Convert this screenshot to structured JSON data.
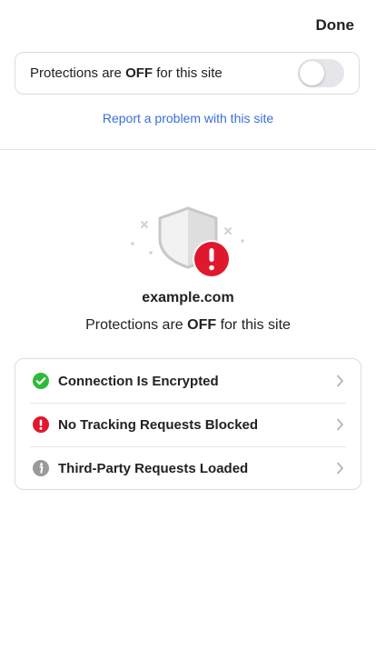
{
  "header": {
    "done_label": "Done"
  },
  "protection_toggle": {
    "prefix": "Protections are ",
    "state": "OFF",
    "suffix": " for this site",
    "enabled": false
  },
  "report_link": "Report a problem with this site",
  "site": {
    "domain": "example.com",
    "status_prefix": "Protections are ",
    "status_state": "OFF",
    "status_suffix": " for this site"
  },
  "details": [
    {
      "label": "Connection Is Encrypted",
      "icon": "check-circle-icon",
      "color": "#2fbb3a"
    },
    {
      "label": "No Tracking Requests Blocked",
      "icon": "exclamation-circle-icon",
      "color": "#e0182d"
    },
    {
      "label": "Third-Party Requests Loaded",
      "icon": "info-circle-icon",
      "color": "#9a9a9a"
    }
  ],
  "colors": {
    "link": "#3a6fd8",
    "alert": "#e0182d",
    "success": "#2fbb3a",
    "neutral": "#9a9a9a"
  }
}
